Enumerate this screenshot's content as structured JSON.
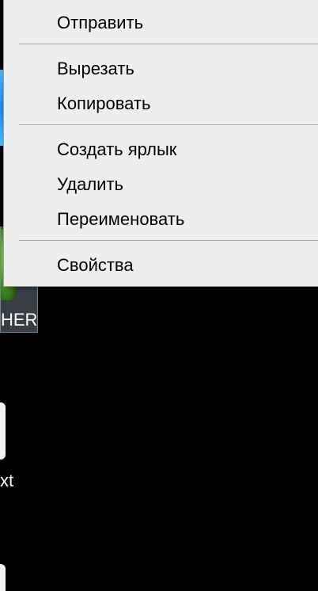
{
  "desktop": {
    "selected_icon_label": "HER",
    "file_icon_label": "xt"
  },
  "context_menu": {
    "items": [
      {
        "label": "Отправить"
      },
      {
        "label": "Вырезать"
      },
      {
        "label": "Копировать"
      },
      {
        "label": "Создать ярлык"
      },
      {
        "label": "Удалить"
      },
      {
        "label": "Переименовать"
      },
      {
        "label": "Свойства"
      }
    ]
  },
  "colors": {
    "menu_background": "#eeeeee",
    "menu_separator": "#a8a8a8",
    "desktop_background": "#000000",
    "selection_highlight": "#8296a5"
  }
}
